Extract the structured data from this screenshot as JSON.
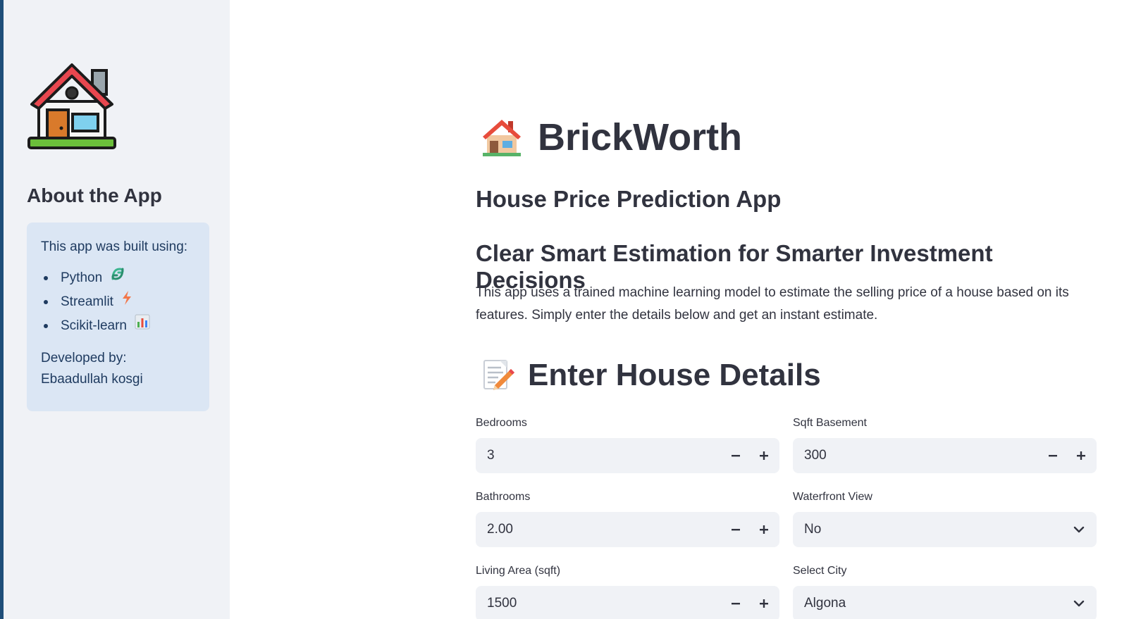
{
  "sidebar": {
    "logo_icon": "house-icon",
    "heading": "About the App",
    "info": {
      "intro": "This app was built using:",
      "tools": [
        {
          "label": "Python",
          "icon": "python-icon"
        },
        {
          "label": "Streamlit",
          "icon": "lightning-icon"
        },
        {
          "label": "Scikit-learn",
          "icon": "bar-chart-icon"
        }
      ],
      "developed_by_label": "Developed by:",
      "developer_name": "Ebaadullah kosgi"
    }
  },
  "main": {
    "title_icon": "house-icon",
    "title": "BrickWorth",
    "subtitle": "House Price Prediction App",
    "tagline": "Clear Smart Estimation for Smarter Investment Decisions",
    "description": "This app uses a trained machine learning model to estimate the selling price of a house based on its features. Simply enter the details below and get an instant estimate.",
    "section_icon": "memo-icon",
    "section_title": "Enter House Details",
    "fields": {
      "bedrooms": {
        "label": "Bedrooms",
        "value": "3"
      },
      "bathrooms": {
        "label": "Bathrooms",
        "value": "2.00"
      },
      "living_area": {
        "label": "Living Area (sqft)",
        "value": "1500"
      },
      "sqft_basement": {
        "label": "Sqft Basement",
        "value": "300"
      },
      "waterfront": {
        "label": "Waterfront View",
        "value": "No"
      },
      "city": {
        "label": "Select City",
        "value": "Algona"
      }
    }
  },
  "colors": {
    "sidebar_bg": "#f0f2f6",
    "info_box_bg": "#dbe6f4",
    "info_text": "#1e3a5f",
    "input_bg": "#f0f2f6",
    "text": "#31333f"
  }
}
